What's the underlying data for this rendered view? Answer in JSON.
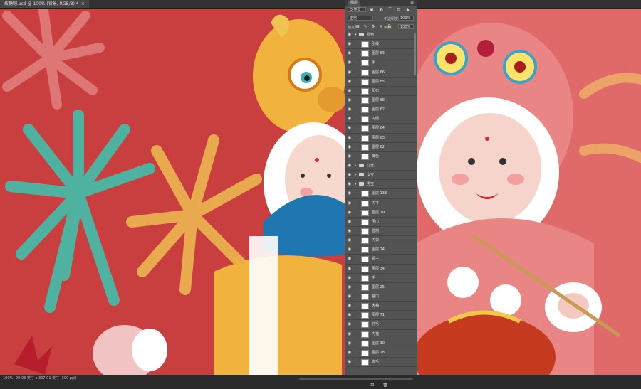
{
  "document": {
    "tab_title": "故糖吧.psd @ 100% (背景, RGB/8) *",
    "close_glyph": "×"
  },
  "statusbar": {
    "zoom": "100%",
    "info": "20.03 英寸 x 397.01 英寸 (300 ppi)"
  },
  "layers_panel": {
    "title": "图层",
    "menu_glyph": "≡",
    "filter_kind": "Q 类型",
    "filter_icons": "▣ ◐ T ⊡ ▲",
    "blend_mode": "正常",
    "opacity_label": "不透明度:",
    "opacity_value": "100%",
    "lock_label": "锁定:",
    "lock_icons": "▦ ✎ ✥ ⊟ 🔒",
    "fill_label": "填充:",
    "fill_value": "100%",
    "footer_icons": "⊖ fx ◑ ◎ ▭ ⊞ 🗑",
    "rows": [
      {
        "type": "group",
        "name": "脸色",
        "expanded": true
      },
      {
        "type": "sub",
        "name": "引线"
      },
      {
        "type": "sub",
        "name": "图层 63"
      },
      {
        "type": "sub",
        "name": "手"
      },
      {
        "type": "sub",
        "name": "图层 66"
      },
      {
        "type": "sub",
        "name": "图层 65"
      },
      {
        "type": "sub",
        "name": "阳布"
      },
      {
        "type": "sub",
        "name": "图层 68"
      },
      {
        "type": "sub",
        "name": "图层 62"
      },
      {
        "type": "sub",
        "name": "内侧"
      },
      {
        "type": "sub",
        "name": "图层 64"
      },
      {
        "type": "sub",
        "name": "图层 63"
      },
      {
        "type": "sub",
        "name": "图层 62"
      },
      {
        "type": "sub",
        "name": "爬色"
      },
      {
        "type": "group",
        "name": "灯笼",
        "expanded": false
      },
      {
        "type": "group",
        "name": "女宝",
        "expanded": false
      },
      {
        "type": "group",
        "name": "男宝",
        "expanded": true
      },
      {
        "type": "sub",
        "name": "图层 133"
      },
      {
        "type": "sub",
        "name": "内寸"
      },
      {
        "type": "sub",
        "name": "图层 19"
      },
      {
        "type": "sub",
        "name": "围巾"
      },
      {
        "type": "sub",
        "name": "脸侧"
      },
      {
        "type": "sub",
        "name": "内领"
      },
      {
        "type": "sub",
        "name": "图层 24"
      },
      {
        "type": "sub",
        "name": "领子"
      },
      {
        "type": "sub",
        "name": "图层 34"
      },
      {
        "type": "sub",
        "name": "手"
      },
      {
        "type": "sub",
        "name": "图层 25"
      },
      {
        "type": "sub",
        "name": "袖口"
      },
      {
        "type": "sub",
        "name": "大袖"
      },
      {
        "type": "sub",
        "name": "图层 71"
      },
      {
        "type": "sub",
        "name": "衬毛"
      },
      {
        "type": "sub",
        "name": "内袖"
      },
      {
        "type": "sub",
        "name": "图层 30"
      },
      {
        "type": "sub",
        "name": "图层 28"
      },
      {
        "type": "sub",
        "name": "白毛"
      },
      {
        "type": "sub",
        "name": "底衫"
      }
    ]
  }
}
